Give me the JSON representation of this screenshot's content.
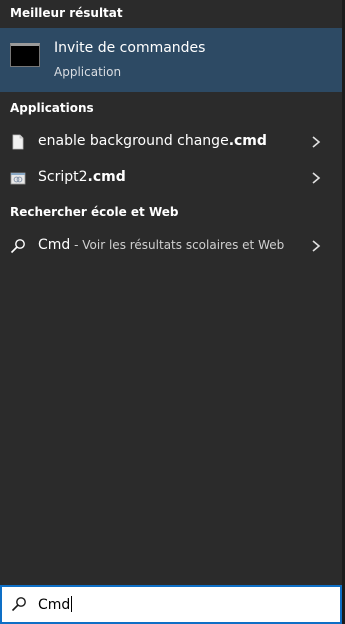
{
  "sections": {
    "best": "Meilleur résultat",
    "apps": "Applications",
    "web": "Rechercher école et Web"
  },
  "best_match": {
    "title": "Invite de commandes",
    "subtitle": "Application",
    "icon": "command-prompt-icon"
  },
  "apps": [
    {
      "prefix": "enable background change",
      "suffix": ".cmd",
      "icon": "file-icon"
    },
    {
      "prefix": "Script2",
      "suffix": ".cmd",
      "icon": "script-file-icon"
    }
  ],
  "web_result": {
    "query": "Cmd",
    "hint": " - Voir les résultats scolaires et Web",
    "icon": "search-icon"
  },
  "search": {
    "value": "Cmd",
    "icon": "search-icon"
  },
  "colors": {
    "background": "#2b2b2b",
    "selection": "#2d4a64",
    "search_border": "#0e6fc6"
  }
}
